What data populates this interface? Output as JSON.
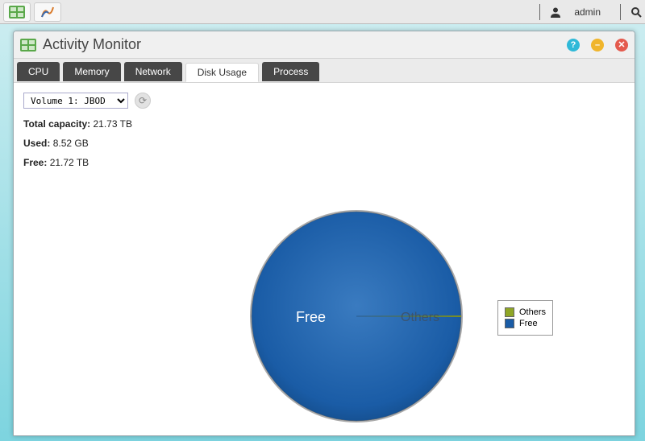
{
  "taskbar": {
    "user_label": "admin"
  },
  "window": {
    "title": "Activity Monitor"
  },
  "tabs": {
    "cpu": "CPU",
    "memory": "Memory",
    "network": "Network",
    "disk": "Disk Usage",
    "process": "Process",
    "active": "disk"
  },
  "disk": {
    "volume_selected": "Volume 1: JBOD",
    "total_label": "Total capacity:",
    "total_value": "21.73 TB",
    "used_label": "Used:",
    "used_value": "8.52 GB",
    "free_label": "Free:",
    "free_value": "21.72 TB"
  },
  "chart_data": {
    "type": "pie",
    "title": "",
    "series": [
      {
        "name": "Others",
        "value": 8.52,
        "unit": "GB",
        "color": "#8fa626"
      },
      {
        "name": "Free",
        "value": 21.72,
        "unit": "TB",
        "color": "#1a5ca6"
      }
    ],
    "labels": {
      "free": "Free",
      "others": "Others"
    },
    "legend": [
      {
        "name": "Others",
        "color": "#8fa626"
      },
      {
        "name": "Free",
        "color": "#1a5ca6"
      }
    ]
  }
}
